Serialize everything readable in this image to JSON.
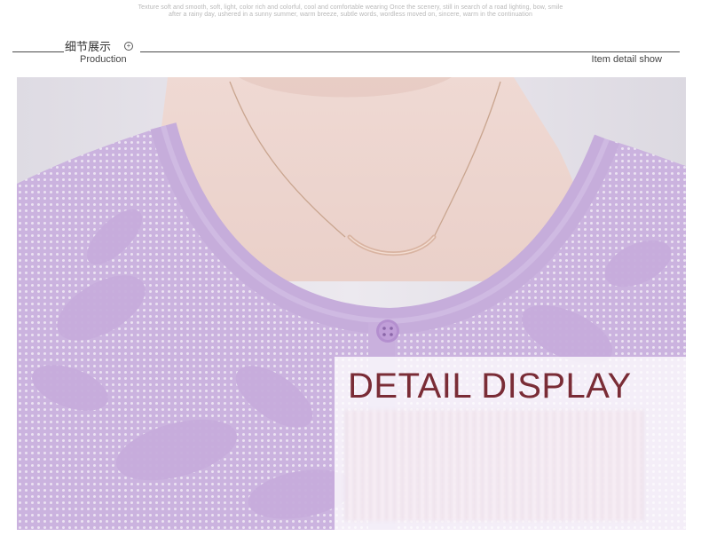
{
  "tagline": {
    "line1": "Texture soft and smooth, soft, light, color rich and colorful, cool and comfortable wearing Once the scenery, still in search of a road lighting, bow, smile",
    "line2": "after a rainy day, ushered in a sunny summer, warm breeze, subtle words, wordless moved on, sincere, warm in the continuation"
  },
  "section": {
    "title_cn": "细节展示",
    "title_en": "Production",
    "right_label": "Item detail show",
    "plus_glyph": "+"
  },
  "overlay": {
    "title": "DETAIL  DISPLAY"
  },
  "colors": {
    "sweater": "#cdb6e1",
    "skin": "#eed6d0",
    "background": "#e6e3ea",
    "title": "#7a2c36",
    "button": "#b48fcf"
  }
}
